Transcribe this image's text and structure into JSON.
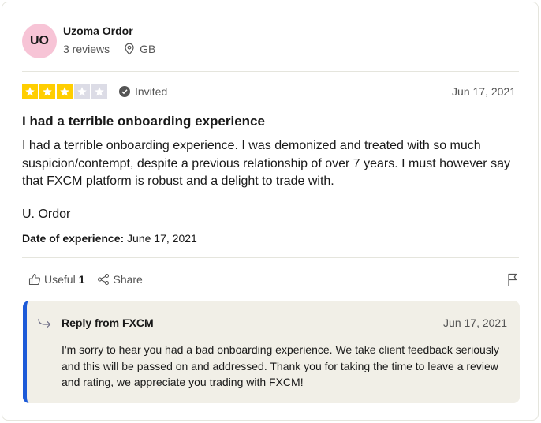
{
  "reviewer": {
    "initials": "UO",
    "name": "Uzoma Ordor",
    "reviews": "3 reviews",
    "country": "GB"
  },
  "rating": {
    "stars": 3,
    "max": 5
  },
  "colors": {
    "star_on": "#ffce00",
    "star_off": "#dcdce6",
    "avatar": "#f7c4d6",
    "reply_accent": "#1c5ad8",
    "reply_bg": "#f1efe7"
  },
  "review": {
    "badge": "Invited",
    "date": "Jun 17, 2021",
    "title": "I had a terrible onboarding experience",
    "body": "I had a terrible onboarding experience. I was demonized and treated with so much suspicion/contempt, despite a previous relationship of over 7 years. I must however say that FXCM platform is robust and a delight to trade with.",
    "signature": "U. Ordor",
    "experience_label": "Date of experience:",
    "experience_date": " June 17, 2021"
  },
  "actions": {
    "useful_label": "Useful",
    "useful_count": "1",
    "share_label": "Share"
  },
  "icons": [
    "location-pin-icon",
    "check-circle-icon",
    "star-icon",
    "thumbs-up-icon",
    "share-icon",
    "flag-icon",
    "reply-arrow-icon"
  ],
  "reply": {
    "title": "Reply from FXCM",
    "date": "Jun 17, 2021",
    "body": "I'm sorry to hear you had a bad onboarding experience. We take client feedback seriously and this will be passed on and addressed. Thank you for taking the time to leave a review and rating, we appreciate you trading with FXCM!"
  }
}
